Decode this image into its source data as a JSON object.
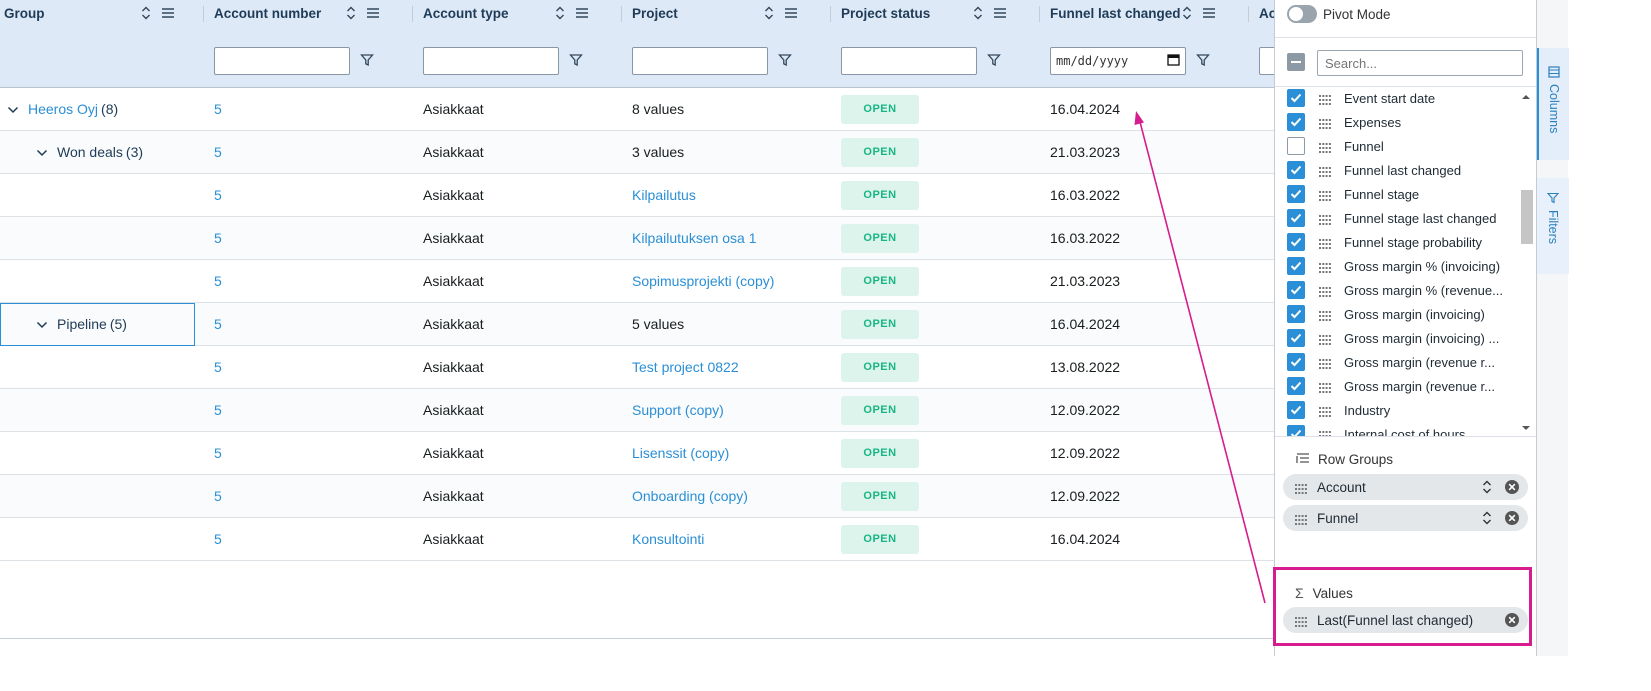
{
  "columns": [
    {
      "title": "Group",
      "filter": "none"
    },
    {
      "title": "Account number",
      "filter": "text"
    },
    {
      "title": "Account type",
      "filter": "text"
    },
    {
      "title": "Project",
      "filter": "text"
    },
    {
      "title": "Project status",
      "filter": "text"
    },
    {
      "title": "Funnel last changed",
      "filter": "date",
      "placeholder": "mm/dd/yyyy"
    },
    {
      "title": "Ac",
      "filter": "text"
    }
  ],
  "rows": [
    {
      "level": 0,
      "group": "Heeros Oyj",
      "count": "(8)",
      "account_number": "5",
      "account_type": "Asiakkaat",
      "project": "8 values",
      "project_is_link": false,
      "status": "OPEN",
      "funnel_last_changed": "16.04.2024"
    },
    {
      "level": 1,
      "group": "Won deals",
      "count": "(3)",
      "account_number": "5",
      "account_type": "Asiakkaat",
      "project": "3 values",
      "project_is_link": false,
      "status": "OPEN",
      "funnel_last_changed": "21.03.2023"
    },
    {
      "level": 2,
      "group": "",
      "count": "",
      "account_number": "5",
      "account_type": "Asiakkaat",
      "project": "Kilpailutus",
      "project_is_link": true,
      "status": "OPEN",
      "funnel_last_changed": "16.03.2022"
    },
    {
      "level": 2,
      "group": "",
      "count": "",
      "account_number": "5",
      "account_type": "Asiakkaat",
      "project": "Kilpailutuksen osa 1",
      "project_is_link": true,
      "status": "OPEN",
      "funnel_last_changed": "16.03.2022"
    },
    {
      "level": 2,
      "group": "",
      "count": "",
      "account_number": "5",
      "account_type": "Asiakkaat",
      "project": "Sopimusprojekti (copy)",
      "project_is_link": true,
      "status": "OPEN",
      "funnel_last_changed": "21.03.2023"
    },
    {
      "level": 1,
      "group": "Pipeline",
      "count": "(5)",
      "account_number": "5",
      "account_type": "Asiakkaat",
      "project": "5 values",
      "project_is_link": false,
      "status": "OPEN",
      "funnel_last_changed": "16.04.2024"
    },
    {
      "level": 2,
      "group": "",
      "count": "",
      "account_number": "5",
      "account_type": "Asiakkaat",
      "project": "Test project 0822",
      "project_is_link": true,
      "status": "OPEN",
      "funnel_last_changed": "13.08.2022"
    },
    {
      "level": 2,
      "group": "",
      "count": "",
      "account_number": "5",
      "account_type": "Asiakkaat",
      "project": "Support (copy)",
      "project_is_link": true,
      "status": "OPEN",
      "funnel_last_changed": "12.09.2022"
    },
    {
      "level": 2,
      "group": "",
      "count": "",
      "account_number": "5",
      "account_type": "Asiakkaat",
      "project": "Lisenssit (copy)",
      "project_is_link": true,
      "status": "OPEN",
      "funnel_last_changed": "12.09.2022"
    },
    {
      "level": 2,
      "group": "",
      "count": "",
      "account_number": "5",
      "account_type": "Asiakkaat",
      "project": "Onboarding (copy)",
      "project_is_link": true,
      "status": "OPEN",
      "funnel_last_changed": "12.09.2022"
    },
    {
      "level": 2,
      "group": "",
      "count": "",
      "account_number": "5",
      "account_type": "Asiakkaat",
      "project": "Konsultointi",
      "project_is_link": true,
      "status": "OPEN",
      "funnel_last_changed": "16.04.2024"
    }
  ],
  "panel": {
    "pivot_mode_label": "Pivot Mode",
    "search_placeholder": "Search...",
    "columns_list": [
      {
        "label": "Event start date",
        "checked": true
      },
      {
        "label": "Expenses",
        "checked": true
      },
      {
        "label": "Funnel",
        "checked": false
      },
      {
        "label": "Funnel last changed",
        "checked": true
      },
      {
        "label": "Funnel stage",
        "checked": true
      },
      {
        "label": "Funnel stage last changed",
        "checked": true
      },
      {
        "label": "Funnel stage probability",
        "checked": true
      },
      {
        "label": "Gross margin % (invoicing)",
        "checked": true
      },
      {
        "label": "Gross margin % (revenue...",
        "checked": true
      },
      {
        "label": "Gross margin (invoicing)",
        "checked": true
      },
      {
        "label": "Gross margin (invoicing) ...",
        "checked": true
      },
      {
        "label": "Gross margin (revenue r...",
        "checked": true
      },
      {
        "label": "Gross margin (revenue r...",
        "checked": true
      },
      {
        "label": "Industry",
        "checked": true
      },
      {
        "label": "Internal cost of hours",
        "checked": true
      }
    ],
    "row_groups_label": "Row Groups",
    "row_groups": [
      "Account",
      "Funnel"
    ],
    "values_label": "Values",
    "values": [
      "Last(Funnel last changed)"
    ]
  },
  "toolbar": {
    "columns_tab": "Columns",
    "filters_tab": "Filters"
  },
  "colors": {
    "header_bg": "#dde9f6",
    "link": "#2a8fd6",
    "badge_bg": "#dcf4ec",
    "badge_text": "#1ab584",
    "highlight": "#d61c8e"
  }
}
